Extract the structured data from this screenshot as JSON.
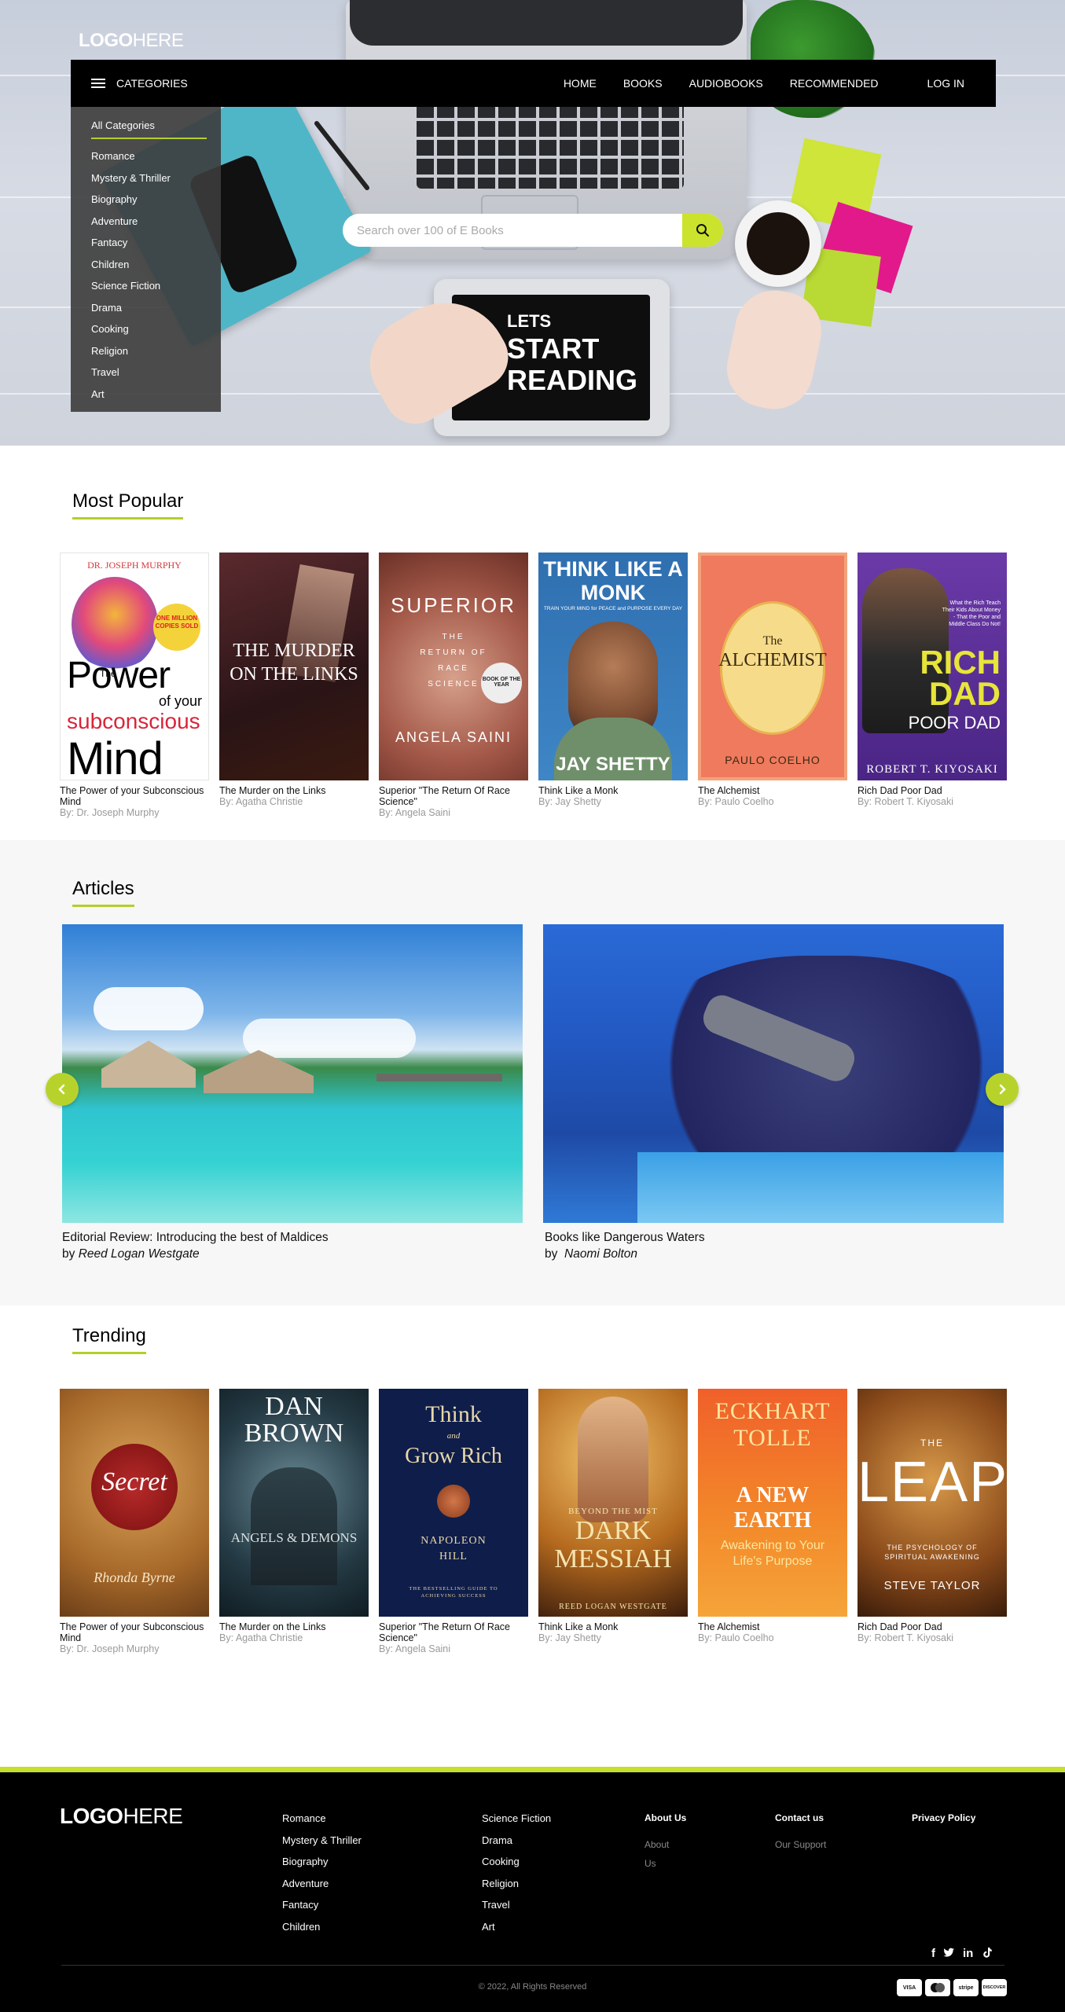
{
  "brand": {
    "logo_bold": "LOGO",
    "logo_light": "HERE"
  },
  "nav": {
    "categories_label": "CATEGORIES",
    "links": [
      "HOME",
      "BOOKS",
      "AUDIOBOOKS",
      "RECOMMENDED"
    ],
    "login": "LOG IN"
  },
  "category_menu": {
    "all": "All Categories",
    "items": [
      "Romance",
      "Mystery & Thriller",
      "Biography",
      "Adventure",
      "Fantacy",
      "Children",
      "Science Fiction",
      "Drama",
      "Cooking",
      "Religion",
      "Travel",
      "Art"
    ]
  },
  "search": {
    "placeholder": "Search over 100 of E Books"
  },
  "hero": {
    "line1": "LETS",
    "line2": "START",
    "line3": "READING"
  },
  "most_popular": {
    "title": "Most Popular",
    "books": [
      {
        "title": "The Power of your Subconscious Mind",
        "author": "By: Dr. Joseph Murphy",
        "cover": {
          "top": "DR. JOSEPH MURPHY",
          "badge": "ONE MILLION COPIES SOLD",
          "w1": "Power",
          "w2": "of your",
          "w3": "subconscious",
          "w4": "Mind",
          "the": "The"
        }
      },
      {
        "title": "The Murder on the Links",
        "author": "By: Agatha Christie",
        "cover": {
          "main": "THE MURDER ON THE LINKS"
        }
      },
      {
        "title": "Superior \"The Return Of Race Science\"",
        "author": "By: Angela Saini",
        "cover": {
          "main": "SUPERIOR",
          "sub": "THE RETURN OF RACE SCIENCE",
          "author": "ANGELA SAINI",
          "badge": "BOOK OF THE YEAR"
        }
      },
      {
        "title": "Think Like a Monk",
        "author": "By: Jay Shetty",
        "cover": {
          "main": "THINK LIKE A MONK",
          "sub": "TRAIN YOUR MIND for PEACE and PURPOSE EVERY DAY",
          "author": "JAY SHETTY"
        }
      },
      {
        "title": "The Alchemist",
        "author": "By: Paulo Coelho",
        "cover": {
          "the": "The",
          "main": "ALCHEMIST",
          "author": "PAULO COELHO"
        }
      },
      {
        "title": "Rich Dad Poor Dad",
        "author": "By: Robert T. Kiyosaki",
        "cover": {
          "tag": "What the Rich Teach Their Kids About Money - That the Poor and Middle Class Do Not!",
          "rich": "RICH",
          "dad": "DAD",
          "poor": "POOR DAD",
          "author": "ROBERT T. KIYOSAKI"
        }
      }
    ]
  },
  "articles": {
    "title": "Articles",
    "items": [
      {
        "title": "Editorial Review: Introducing the best of Maldices",
        "by": "by",
        "author": "Reed Logan Westgate"
      },
      {
        "title": "Books like Dangerous Waters",
        "by": "by",
        "author": "Naomi Bolton"
      }
    ]
  },
  "trending": {
    "title": "Trending",
    "books": [
      {
        "title": "The Power of your Subconscious Mind",
        "author": "By: Dr. Joseph Murphy",
        "cover": {
          "main": "Secret",
          "author": "Rhonda Byrne"
        }
      },
      {
        "title": "The Murder on the Links",
        "author": "By: Agatha Christie",
        "cover": {
          "a1": "DAN",
          "a2": "BROWN",
          "main": "ANGELS & DEMONS"
        }
      },
      {
        "title": "Superior \"The Return Of Race Science\"",
        "author": "By: Angela Saini",
        "cover": {
          "l1": "Think",
          "l2": "and",
          "l3": "Grow Rich",
          "a1": "NAPOLEON",
          "a2": "HILL",
          "sub": "THE BESTSELLING GUIDE TO ACHIEVING SUCCESS"
        }
      },
      {
        "title": "Think Like a Monk",
        "author": "By: Jay Shetty",
        "cover": {
          "pre": "BEYOND THE MIST",
          "l1": "DARK",
          "l2": "MESSIAH",
          "author": "REED LOGAN WESTGATE"
        }
      },
      {
        "title": "The Alchemist",
        "author": "By: Paulo Coelho",
        "cover": {
          "a1": "ECKHART",
          "a2": "TOLLE",
          "l1": "A NEW",
          "l2": "EARTH",
          "sub": "Awakening to Your Life's Purpose"
        }
      },
      {
        "title": "Rich Dad Poor Dad",
        "author": "By: Robert T. Kiyosaki",
        "cover": {
          "main": "LEAP",
          "the": "THE",
          "sub": "THE PSYCHOLOGY OF SPIRITUAL AWAKENING",
          "author": "STEVE TAYLOR"
        }
      }
    ]
  },
  "footer": {
    "col1": [
      "Romance",
      "Mystery & Thriller",
      "Biography",
      "Adventure",
      "Fantacy",
      "Children"
    ],
    "col2": [
      "Science Fiction",
      "Drama",
      "Cooking",
      "Religion",
      "Travel",
      "Art"
    ],
    "about": {
      "heading": "About Us",
      "l1": "About",
      "l2": "Us"
    },
    "contact": {
      "heading": "Contact us",
      "l1": "Our Support"
    },
    "privacy": "Privacy Policy",
    "copyright": "© 2022, All Rights Reserved",
    "socials": [
      "f",
      "t",
      "in",
      "tiktok"
    ],
    "payments": [
      "VISA",
      "mastercard",
      "stripe",
      "DISCOVER"
    ]
  },
  "colors": {
    "accent": "#c5df2a",
    "nav": "#000000",
    "footer": "#000000"
  }
}
